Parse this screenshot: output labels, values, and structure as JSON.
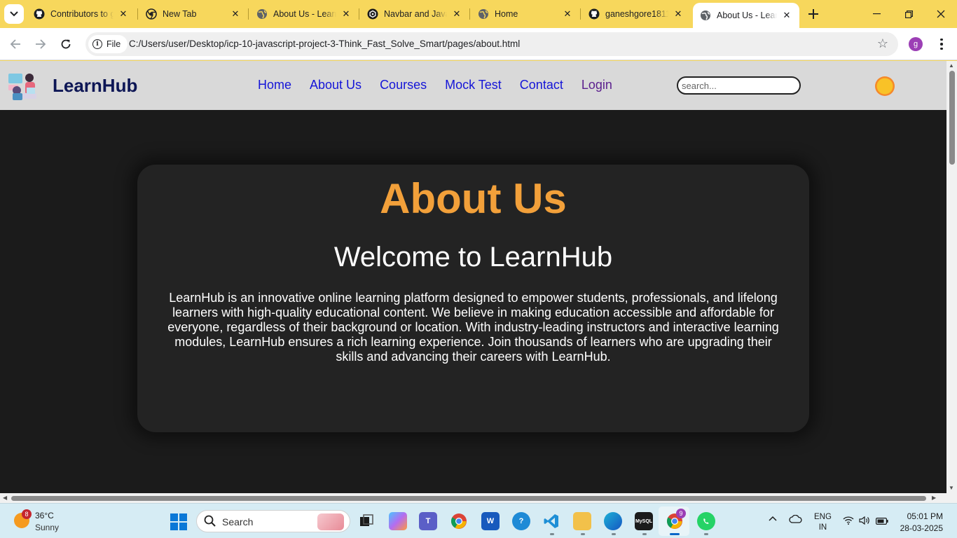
{
  "browser": {
    "tabs": [
      {
        "title": "Contributors to g",
        "favicon": "github-icon"
      },
      {
        "title": "New Tab",
        "favicon": "chrome-icon"
      },
      {
        "title": "About Us - Learn",
        "favicon": "globe-icon"
      },
      {
        "title": "Navbar and Java",
        "favicon": "chatgpt-icon"
      },
      {
        "title": "Home",
        "favicon": "globe-icon"
      },
      {
        "title": "ganeshgore1811",
        "favicon": "github-icon"
      },
      {
        "title": "About Us - Learn",
        "favicon": "globe-icon",
        "active": true
      }
    ],
    "omnibox": {
      "scheme_label": "File",
      "url": "C:/Users/user/Desktop/icp-10-javascript-project-3-Think_Fast_Solve_Smart/pages/about.html"
    },
    "profile_initial": "g",
    "tab_strip_color": "#f7d75c"
  },
  "site": {
    "brand": "LearnHub",
    "nav": [
      "Home",
      "About Us",
      "Courses",
      "Mock Test",
      "Contact",
      "Login"
    ],
    "search_placeholder": "search...",
    "theme_toggle_icon": "sun-icon"
  },
  "about": {
    "heading": "About Us",
    "subheading": "Welcome to LearnHub",
    "body": "LearnHub is an innovative online learning platform designed to empower students, professionals, and lifelong learners with high-quality educational content. We believe in making education accessible and affordable for everyone, regardless of their background or location. With industry-leading instructors and interactive learning modules, LearnHub ensures a rich learning experience. Join thousands of learners who are upgrading their skills and advancing their careers with LearnHub.",
    "heading_color": "#f2a03a"
  },
  "taskbar": {
    "weather": {
      "temp": "36°C",
      "condition": "Sunny",
      "badge": "8"
    },
    "search_label": "Search",
    "chrome_badge": "9",
    "language": {
      "line1": "ENG",
      "line2": "IN"
    },
    "clock": {
      "time": "05:01 PM",
      "date": "28-03-2025"
    }
  }
}
